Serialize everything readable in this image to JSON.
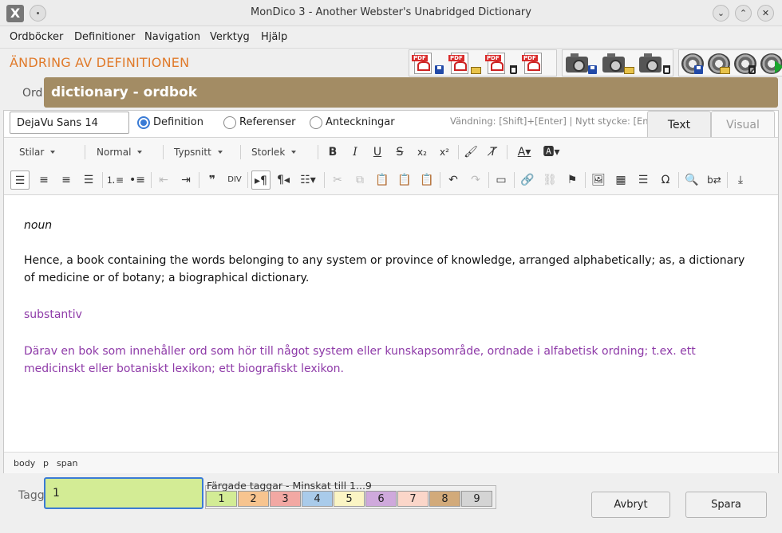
{
  "window": {
    "title": "MonDico 3 - Another Webster's Unabridged Dictionary",
    "app_icon_glyph": "X"
  },
  "menu": [
    "Ordböcker",
    "Definitioner",
    "Navigation",
    "Verktyg",
    "Hjälp"
  ],
  "heading": "ÄNDRING AV DEFINITIONEN",
  "word": {
    "label": "Ord",
    "value": "dictionary - ordbok"
  },
  "editor": {
    "font_value": "DejaVu Sans 14",
    "radios": [
      {
        "label": "Definition",
        "selected": true
      },
      {
        "label": "Referenser",
        "selected": false
      },
      {
        "label": "Anteckningar",
        "selected": false
      }
    ],
    "hint": "Vändning: [Shift]+[Enter] | Nytt stycke: [Enter]",
    "tabs": {
      "text": "Text",
      "visual": "Visual"
    },
    "dropdowns": {
      "styles": "Stilar",
      "format": "Normal",
      "font": "Typsnitt",
      "size": "Storlek"
    },
    "content": {
      "pos_en": "noun",
      "def_en": "Hence, a book containing the words belonging to any system or province of knowledge, arranged alphabetically; as, a dictionary of medicine or of botany; a biographical dictionary.",
      "pos_sv": "substantiv",
      "def_sv": "Därav en bok som innehåller ord som hör till något system eller kunskapsområde, ordnade i alfabetisk ordning; t.ex. ett medicinskt eller botaniskt lexikon; ett biografiskt lexikon."
    },
    "path": [
      "body",
      "p",
      "span"
    ]
  },
  "tags": {
    "label": "Tagg",
    "value": "1",
    "legend": "Färgade taggar - Minskat till 1...9",
    "items": [
      {
        "label": "1",
        "color": "#d3ec95"
      },
      {
        "label": "2",
        "color": "#f7c48f"
      },
      {
        "label": "3",
        "color": "#f2a8a3"
      },
      {
        "label": "4",
        "color": "#a9cbea"
      },
      {
        "label": "5",
        "color": "#fbf5c4"
      },
      {
        "label": "6",
        "color": "#cfa9dc"
      },
      {
        "label": "7",
        "color": "#fbd6c9"
      },
      {
        "label": "8",
        "color": "#d2aa7a"
      },
      {
        "label": "9",
        "color": "#d4d4d4"
      }
    ]
  },
  "buttons": {
    "cancel": "Avbryt",
    "save": "Spara"
  },
  "colors": {
    "heading": "#e07a2a",
    "word_bar": "#a38c64",
    "swedish_text": "#8e3aa8",
    "focus": "#3a7bd5"
  },
  "toolbar_icons": {
    "row1": [
      "bold-icon",
      "italic-icon",
      "underline-icon",
      "strikethrough-icon",
      "subscript-icon",
      "superscript-icon",
      "format-painter-icon",
      "clear-format-icon",
      "text-color-icon",
      "highlight-color-icon"
    ],
    "row2": [
      "align-left-icon",
      "align-center-icon",
      "align-right-icon",
      "justify-icon",
      "numbered-list-icon",
      "bullet-list-icon",
      "outdent-icon",
      "indent-icon",
      "blockquote-icon",
      "spellcheck-icon",
      "ltr-icon",
      "rtl-icon",
      "styles-list-icon",
      "cut-icon",
      "copy-icon",
      "paste-icon",
      "paste-text-icon",
      "paste-word-icon",
      "undo-icon",
      "redo-icon",
      "form-field-icon",
      "link-icon",
      "unlink-icon",
      "anchor-flag-icon",
      "image-icon",
      "table-icon",
      "horizontal-rule-icon",
      "special-char-icon",
      "find-icon",
      "replace-icon",
      "page-break-icon"
    ]
  }
}
